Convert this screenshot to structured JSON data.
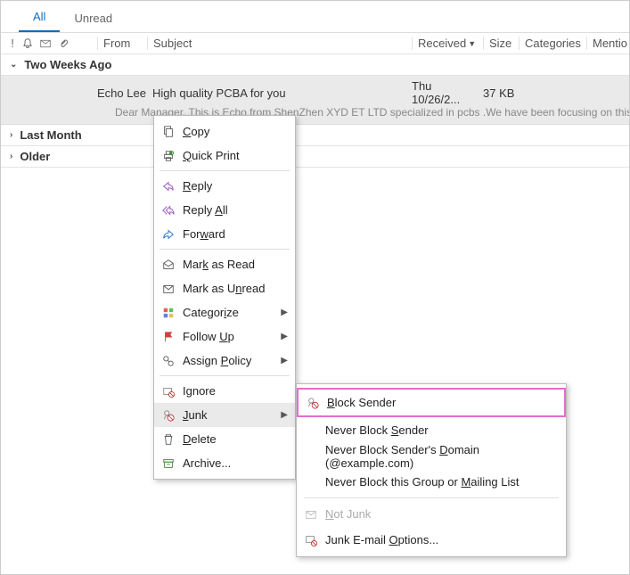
{
  "tabs": {
    "all": "All",
    "unread": "Unread"
  },
  "columns": {
    "from": "From",
    "subject": "Subject",
    "received": "Received",
    "size": "Size",
    "categories": "Categories",
    "mentions": "Mentio"
  },
  "groups": {
    "two_weeks": "Two Weeks Ago",
    "last_month": "Last Month",
    "older": "Older"
  },
  "mail": {
    "from": "Echo Lee",
    "subject": "High quality PCBA for you",
    "received": "Thu 10/26/2...",
    "size": "37 KB",
    "preview": "Dear Manager,  This is Echo from ShenZhen XYD ET LTD specialized in pcbs .We have been focusing on this field for se"
  },
  "context_menu": {
    "copy": "Copy",
    "quick_print": "Quick Print",
    "reply": "Reply",
    "reply_all": "Reply All",
    "forward": "Forward",
    "mark_read": "Mark as Read",
    "mark_unread": "Mark as Unread",
    "categorize": "Categorize",
    "follow_up": "Follow Up",
    "assign_policy": "Assign Policy",
    "ignore": "Ignore",
    "junk": "Junk",
    "delete": "Delete",
    "archive": "Archive..."
  },
  "junk_submenu": {
    "block_sender": "Block Sender",
    "never_block_sender": "Never Block Sender",
    "never_block_domain": "Never Block Sender's Domain (@example.com)",
    "never_block_group": "Never Block this Group or Mailing List",
    "not_junk": "Not Junk",
    "junk_options": "Junk E-mail Options..."
  },
  "colors": {
    "accent": "#0f6cbd",
    "highlight": "#e66ccf"
  }
}
